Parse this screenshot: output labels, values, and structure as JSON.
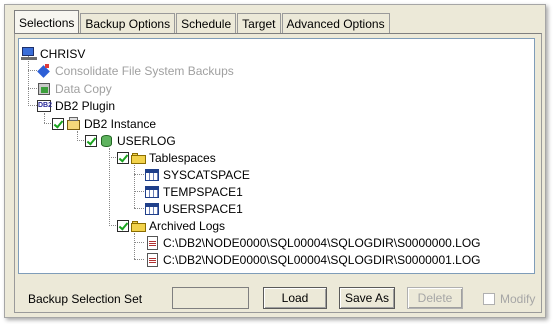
{
  "tabs": [
    {
      "label": "Selections",
      "active": true
    },
    {
      "label": "Backup Options",
      "active": false
    },
    {
      "label": "Schedule",
      "active": false
    },
    {
      "label": "Target",
      "active": false
    },
    {
      "label": "Advanced Options",
      "active": false
    }
  ],
  "tree": {
    "root": {
      "label": "CHRISV",
      "icon": "computer-icon"
    },
    "consolidate": {
      "label": "Consolidate File System Backups",
      "icon": "consolidate-icon",
      "disabled": true
    },
    "data_copy": {
      "label": "Data Copy",
      "icon": "data-copy-icon",
      "disabled": true
    },
    "db2_plugin": {
      "label": "DB2 Plugin",
      "icon": "db2-icon"
    },
    "db2_instance": {
      "label": "DB2 Instance",
      "icon": "instance-icon",
      "checked": true
    },
    "userlog": {
      "label": "USERLOG",
      "icon": "database-icon",
      "checked": true
    },
    "tablespaces": {
      "label": "Tablespaces",
      "icon": "folder-icon",
      "checked": true
    },
    "syscatspace": {
      "label": "SYSCATSPACE",
      "icon": "table-icon"
    },
    "tempspace1": {
      "label": "TEMPSPACE1",
      "icon": "table-icon"
    },
    "userspace1": {
      "label": "USERSPACE1",
      "icon": "table-icon"
    },
    "archived_logs": {
      "label": "Archived Logs",
      "icon": "folder-icon",
      "checked": true
    },
    "log0": {
      "label": "C:\\DB2\\NODE0000\\SQL00004\\SQLOGDIR\\S0000000.LOG",
      "icon": "log-file-icon"
    },
    "log1": {
      "label": "C:\\DB2\\NODE0000\\SQL00004\\SQLOGDIR\\S0000001.LOG",
      "icon": "log-file-icon"
    }
  },
  "bottom": {
    "selection_set_label": "Backup Selection  Set",
    "selection_set_value": "",
    "load_label": "Load",
    "save_as_label": "Save As",
    "delete_label": "Delete",
    "modify_label": "Modify",
    "modify_checked": false
  }
}
